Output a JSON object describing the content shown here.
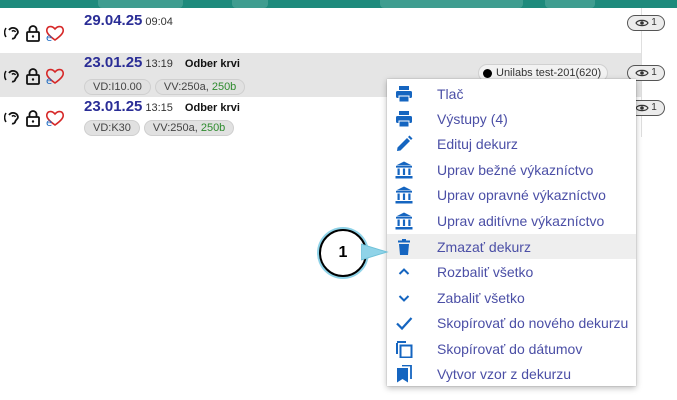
{
  "records": [
    {
      "date": "29.04.25",
      "time": "09:04",
      "title": "",
      "chips": [],
      "views": "1"
    },
    {
      "date": "23.01.25",
      "time": "13:19",
      "title": "Odber krvi",
      "chip1": "VD:I10.00",
      "chip2_a": "VV:250a, ",
      "chip2_b": "250b",
      "lab": "Unilabs test-201(620)",
      "views": "1"
    },
    {
      "date": "23.01.25",
      "time": "13:15",
      "title": "Odber krvi",
      "chip1": "VD:K30",
      "chip2_a": "VV:250a, ",
      "chip2_b": "250b",
      "views": "1"
    }
  ],
  "menu": [
    {
      "label": "Tlač",
      "icon": "printer-icon"
    },
    {
      "label": "Výstupy (4)",
      "icon": "printer-icon"
    },
    {
      "label": "Edituj dekurz",
      "icon": "pencil-icon"
    },
    {
      "label": "Uprav bežné výkazníctvo",
      "icon": "bank-icon"
    },
    {
      "label": "Uprav opravné výkazníctvo",
      "icon": "bank-icon"
    },
    {
      "label": "Uprav aditívne výkazníctvo",
      "icon": "bank-icon"
    },
    {
      "label": "Zmazať dekurz",
      "icon": "trash-icon"
    },
    {
      "label": "Rozbaliť všetko",
      "icon": "chevron-up-icon"
    },
    {
      "label": "Zabaliť všetko",
      "icon": "chevron-down-icon"
    },
    {
      "label": "Skopírovať do nového dekurzu",
      "icon": "check-icon"
    },
    {
      "label": "Skopírovať do dátumov",
      "icon": "copy-icon"
    },
    {
      "label": "Vytvor vzor z dekurzu",
      "icon": "bookmark-icon"
    }
  ],
  "callout": {
    "number": "1"
  },
  "colors": {
    "accent": "#1e8a7c",
    "menu_text": "#4b4fa6",
    "icon_blue": "#1565c0",
    "date_blue": "#2a2d96"
  }
}
